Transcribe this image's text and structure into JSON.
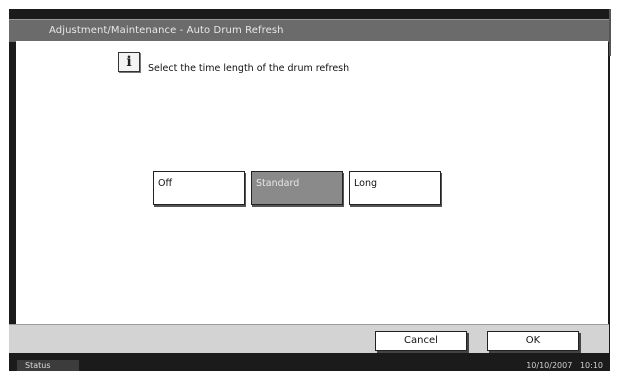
{
  "window": {
    "title": "Adjustment/Maintenance - Auto Drum Refresh"
  },
  "info": {
    "icon": "info-icon",
    "icon_glyph": "i",
    "message": "Select the time length of the drum refresh"
  },
  "options": [
    {
      "label": "Off",
      "selected": false
    },
    {
      "label": "Standard",
      "selected": true
    },
    {
      "label": "Long",
      "selected": false
    }
  ],
  "footer": {
    "cancel_label": "Cancel",
    "ok_label": "OK"
  },
  "status_bar": {
    "status_label": "Status",
    "date": "10/10/2007",
    "time": "10:10"
  },
  "colors": {
    "title_bar": "#6b6b6b",
    "selected_option": "#8a8a8a",
    "bottom_bar": "#d3d3d3",
    "frame": "#1b1b1b"
  }
}
